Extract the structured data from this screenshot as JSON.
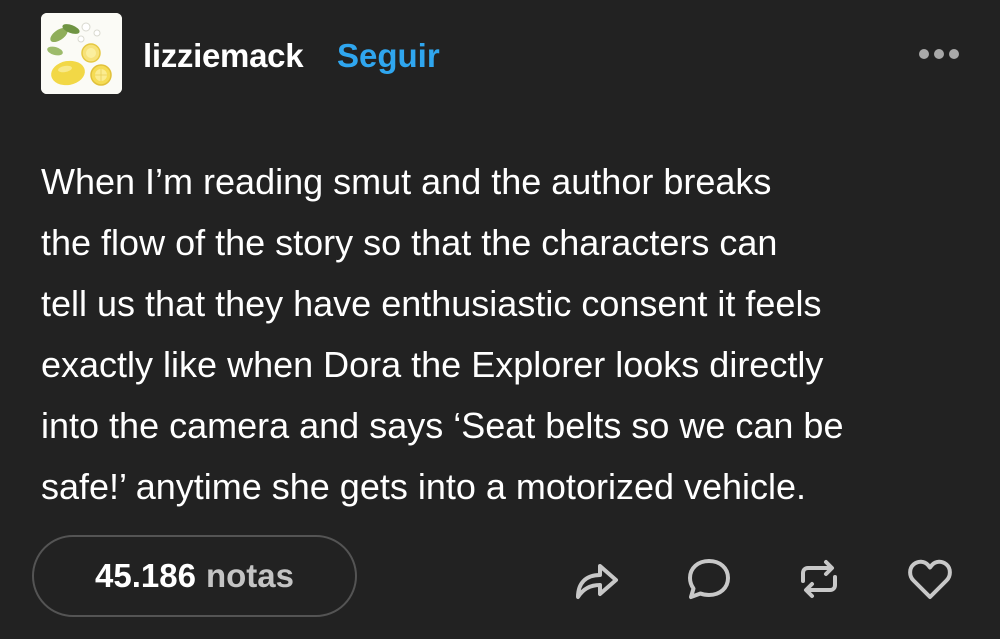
{
  "header": {
    "username": "lizziemack",
    "follow_label": "Seguir",
    "avatar_icon": "lemon-illustration-avatar",
    "more_icon": "more-options-icon"
  },
  "post": {
    "text_lines": [
      "When I’m reading smut and the author breaks",
      "the flow of the story so that the characters can",
      "tell us that they have enthusiastic consent it feels",
      "exactly like when Dora the Explorer looks directly",
      "into the camera and says ‘Seat belts so we can be",
      "safe!’ anytime she gets into a motorized vehicle."
    ]
  },
  "footer": {
    "notes_count": "45.186",
    "notes_label": "notas",
    "actions": [
      "share-icon",
      "reply-icon",
      "reblog-icon",
      "like-icon"
    ]
  },
  "colors": {
    "background": "#222222",
    "accent": "#2fa6ef",
    "text": "#ffffff",
    "muted": "#c4c4c4"
  }
}
